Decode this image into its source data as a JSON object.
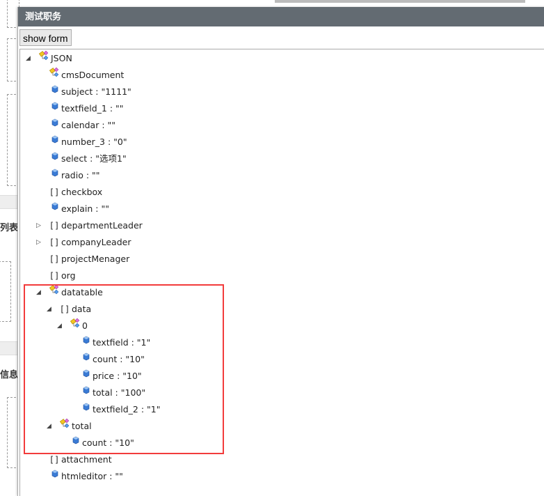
{
  "background": {
    "labels": [
      "列表",
      "信息"
    ]
  },
  "dialog": {
    "title": "测试职务",
    "show_form_label": "show form"
  },
  "colors": {
    "titlebar": "#636b72",
    "highlight": "#f23b3b"
  },
  "tree": [
    {
      "label": "JSON",
      "level": 0,
      "icon": "object-icon",
      "expander": "expanded"
    },
    {
      "label": "cmsDocument",
      "level": 1,
      "icon": "object-icon",
      "expander": "none"
    },
    {
      "label": "subject : \"1111\"",
      "level": 1,
      "icon": "value-icon",
      "expander": "none"
    },
    {
      "label": "textfield_1 : \"\"",
      "level": 1,
      "icon": "value-icon",
      "expander": "none"
    },
    {
      "label": "calendar : \"\"",
      "level": 1,
      "icon": "value-icon",
      "expander": "none"
    },
    {
      "label": "number_3 : \"0\"",
      "level": 1,
      "icon": "value-icon",
      "expander": "none"
    },
    {
      "label": "select : \"选项1\"",
      "level": 1,
      "icon": "value-icon",
      "expander": "none"
    },
    {
      "label": "radio : \"\"",
      "level": 1,
      "icon": "value-icon",
      "expander": "none"
    },
    {
      "label": "checkbox",
      "level": 1,
      "icon": "array-icon",
      "expander": "none"
    },
    {
      "label": "explain : \"\"",
      "level": 1,
      "icon": "value-icon",
      "expander": "none"
    },
    {
      "label": "departmentLeader",
      "level": 1,
      "icon": "array-icon",
      "expander": "collapsed"
    },
    {
      "label": "companyLeader",
      "level": 1,
      "icon": "array-icon",
      "expander": "collapsed"
    },
    {
      "label": "projectMenager",
      "level": 1,
      "icon": "array-icon",
      "expander": "none"
    },
    {
      "label": "org",
      "level": 1,
      "icon": "array-icon",
      "expander": "none"
    },
    {
      "label": "datatable",
      "level": 1,
      "icon": "object-icon",
      "expander": "expanded"
    },
    {
      "label": "data",
      "level": 2,
      "icon": "array-icon",
      "expander": "expanded"
    },
    {
      "label": "0",
      "level": 3,
      "icon": "object-icon",
      "expander": "expanded"
    },
    {
      "label": "textfield : \"1\"",
      "level": 4,
      "icon": "value-icon",
      "expander": "none"
    },
    {
      "label": "count : \"10\"",
      "level": 4,
      "icon": "value-icon",
      "expander": "none"
    },
    {
      "label": "price : \"10\"",
      "level": 4,
      "icon": "value-icon",
      "expander": "none"
    },
    {
      "label": "total : \"100\"",
      "level": 4,
      "icon": "value-icon",
      "expander": "none"
    },
    {
      "label": "textfield_2 : \"1\"",
      "level": 4,
      "icon": "value-icon",
      "expander": "none"
    },
    {
      "label": "total",
      "level": 2,
      "icon": "object-icon",
      "expander": "expanded"
    },
    {
      "label": "count : \"10\"",
      "level": 3,
      "icon": "value-icon",
      "expander": "none"
    },
    {
      "label": "attachment",
      "level": 1,
      "icon": "array-icon",
      "expander": "none"
    },
    {
      "label": "htmleditor : \"\"",
      "level": 1,
      "icon": "value-icon",
      "expander": "none"
    }
  ]
}
